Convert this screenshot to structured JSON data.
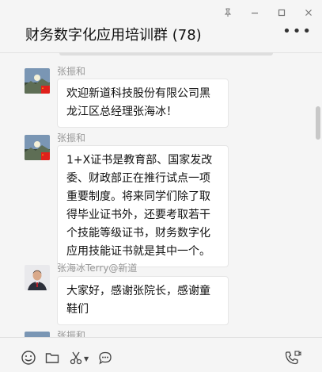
{
  "window": {
    "title": "财务数字化应用培训群 (78)",
    "more_label": "•••",
    "controls": [
      "pin-icon",
      "minimize-icon",
      "maximize-icon",
      "close-icon"
    ]
  },
  "messages": [
    {
      "sender": "张振和",
      "text": "欢迎新道科技股份有限公司黑龙江区总经理张海冰！",
      "avatar": "landscape-flag-avatar"
    },
    {
      "sender": "张振和",
      "text": "1+X证书是教育部、国家发改委、财政部正在推行试点一项重要制度。将来同学们除了取得毕业证书外，还要考取若干个技能等级证书，财务数字化应用技能证书就是其中一个。",
      "avatar": "landscape-flag-avatar"
    },
    {
      "sender": "张海冰Terry@新道",
      "text": "大家好，感谢张院长，感谢童鞋们",
      "avatar": "person-photo-avatar"
    },
    {
      "sender": "张振和",
      "text": "",
      "avatar": "landscape-flag-avatar"
    }
  ],
  "toolbar": {
    "tools": [
      "emoji-icon",
      "folder-icon",
      "scissors-icon",
      "chat-bubble-icon",
      "video-call-icon"
    ]
  },
  "colors": {
    "background": "#f5f5f5",
    "bubble": "#ffffff",
    "sender_text": "#999999",
    "flag_red": "#e0201b"
  }
}
